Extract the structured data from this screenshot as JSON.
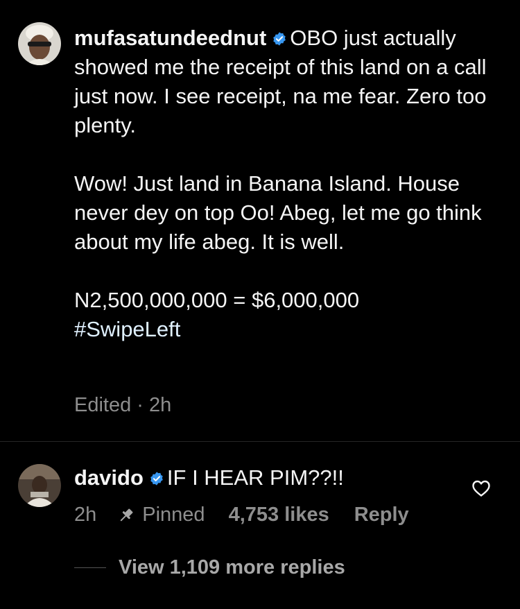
{
  "colors": {
    "background": "#000000",
    "text": "#f5f5f5",
    "secondary": "#8e8e8e",
    "verified": "#3897f0",
    "hashtag": "#e0f1ff"
  },
  "comment": {
    "username": "mufasatundeednut",
    "verified_icon": "verified-badge-icon",
    "line1": "OBO just actually showed me the receipt of this land on a call just now. I see receipt, na me fear. Zero too plenty.",
    "para2": "Wow! Just land in Banana Island. House never dey on top Oo! Abeg, let me go think about my life abeg. It is well.",
    "para3_amount": "N2,500,000,000 = $6,000,000",
    "hashtag": "#SwipeLeft",
    "meta": "Edited · 2h"
  },
  "reply": {
    "username": "davido",
    "verified_icon": "verified-badge-icon",
    "text": "IF I HEAR PIM??!!",
    "time": "2h",
    "pin_icon": "pin-icon",
    "pinned_label": "Pinned",
    "likes": "4,753 likes",
    "reply_label": "Reply",
    "heart_icon": "heart-outline-icon"
  },
  "view_more": {
    "label": "View 1,109 more replies"
  }
}
